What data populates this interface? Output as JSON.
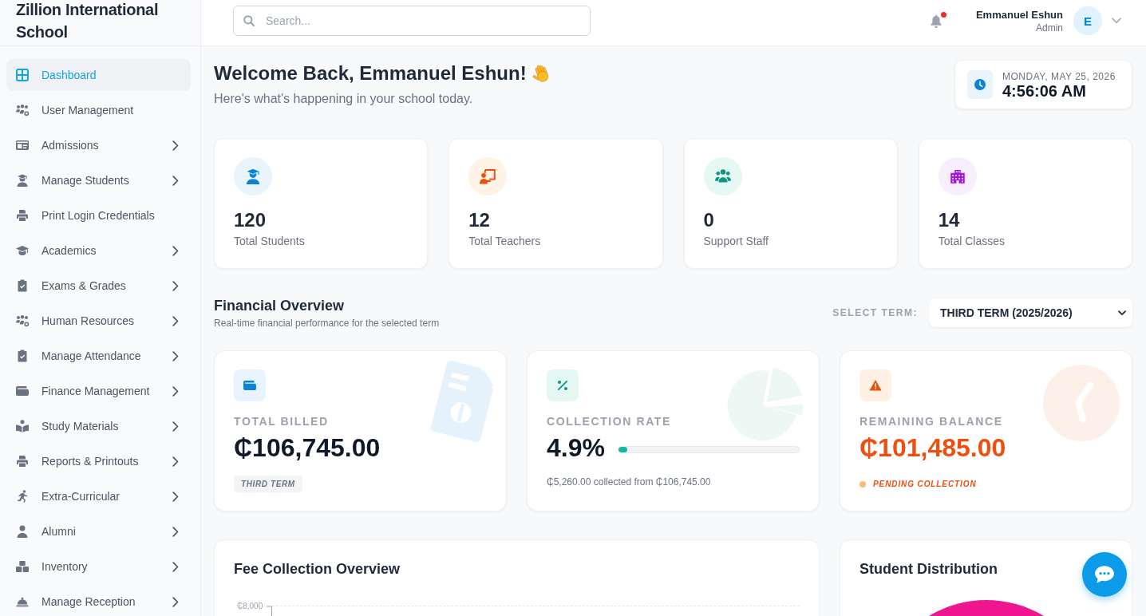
{
  "sidebar": {
    "school_name": "Zillion International School",
    "items": [
      {
        "label": "Dashboard",
        "selected": true,
        "expandable": false
      },
      {
        "label": "User Management",
        "selected": false,
        "expandable": false
      },
      {
        "label": "Admissions",
        "selected": false,
        "expandable": true
      },
      {
        "label": "Manage Students",
        "selected": false,
        "expandable": true
      },
      {
        "label": "Print Login Credentials",
        "selected": false,
        "expandable": false
      },
      {
        "label": "Academics",
        "selected": false,
        "expandable": true
      },
      {
        "label": "Exams & Grades",
        "selected": false,
        "expandable": true
      },
      {
        "label": "Human Resources",
        "selected": false,
        "expandable": true
      },
      {
        "label": "Manage Attendance",
        "selected": false,
        "expandable": true
      },
      {
        "label": "Finance Management",
        "selected": false,
        "expandable": true
      },
      {
        "label": "Study Materials",
        "selected": false,
        "expandable": true
      },
      {
        "label": "Reports & Printouts",
        "selected": false,
        "expandable": true
      },
      {
        "label": "Extra-Curricular",
        "selected": false,
        "expandable": true
      },
      {
        "label": "Alumni",
        "selected": false,
        "expandable": true
      },
      {
        "label": "Inventory",
        "selected": false,
        "expandable": true
      },
      {
        "label": "Manage Reception",
        "selected": false,
        "expandable": true
      }
    ]
  },
  "header": {
    "search": {
      "placeholder": "Search..."
    },
    "notifications": {
      "unread": true
    },
    "user": {
      "name": "Emmanuel Eshun",
      "role": "Admin",
      "initial": "E"
    }
  },
  "welcome": {
    "title": "Welcome Back, Emmanuel Eshun!",
    "subtitle": "Here's what's happening in your school today."
  },
  "clock_card": {
    "date": "MONDAY, MAY 25, 2026",
    "time": "4:56:06 AM"
  },
  "stats": [
    {
      "value": "120",
      "label": "Total Students"
    },
    {
      "value": "12",
      "label": "Total Teachers"
    },
    {
      "value": "0",
      "label": "Support Staff"
    },
    {
      "value": "14",
      "label": "Total Classes"
    }
  ],
  "financial_overview": {
    "title": "Financial Overview",
    "subtitle": "Real-time financial performance for the selected term",
    "term_label": "SELECT TERM:",
    "term_select": {
      "value": "THIRD TERM (2025/2026)"
    },
    "cards": [
      {
        "kind": "tag",
        "label": "TOTAL BILLED",
        "value": "₵106,745.00",
        "tag": "THIRD TERM"
      },
      {
        "kind": "progress",
        "label": "COLLECTION RATE",
        "value": "4.9%",
        "level": 0.049,
        "note": "₵5,260.00 collected from ₵106,745.00"
      },
      {
        "kind": "status",
        "label": "REMAINING BALANCE",
        "value": "₵101,485.00",
        "status": "PENDING COLLECTION"
      }
    ]
  },
  "panels": [
    {
      "kind": "axis_chart",
      "title": "Fee Collection Overview",
      "y_tick_labels": [
        "₵8,000"
      ]
    },
    {
      "kind": "donut",
      "title": "Student Distribution"
    }
  ]
}
